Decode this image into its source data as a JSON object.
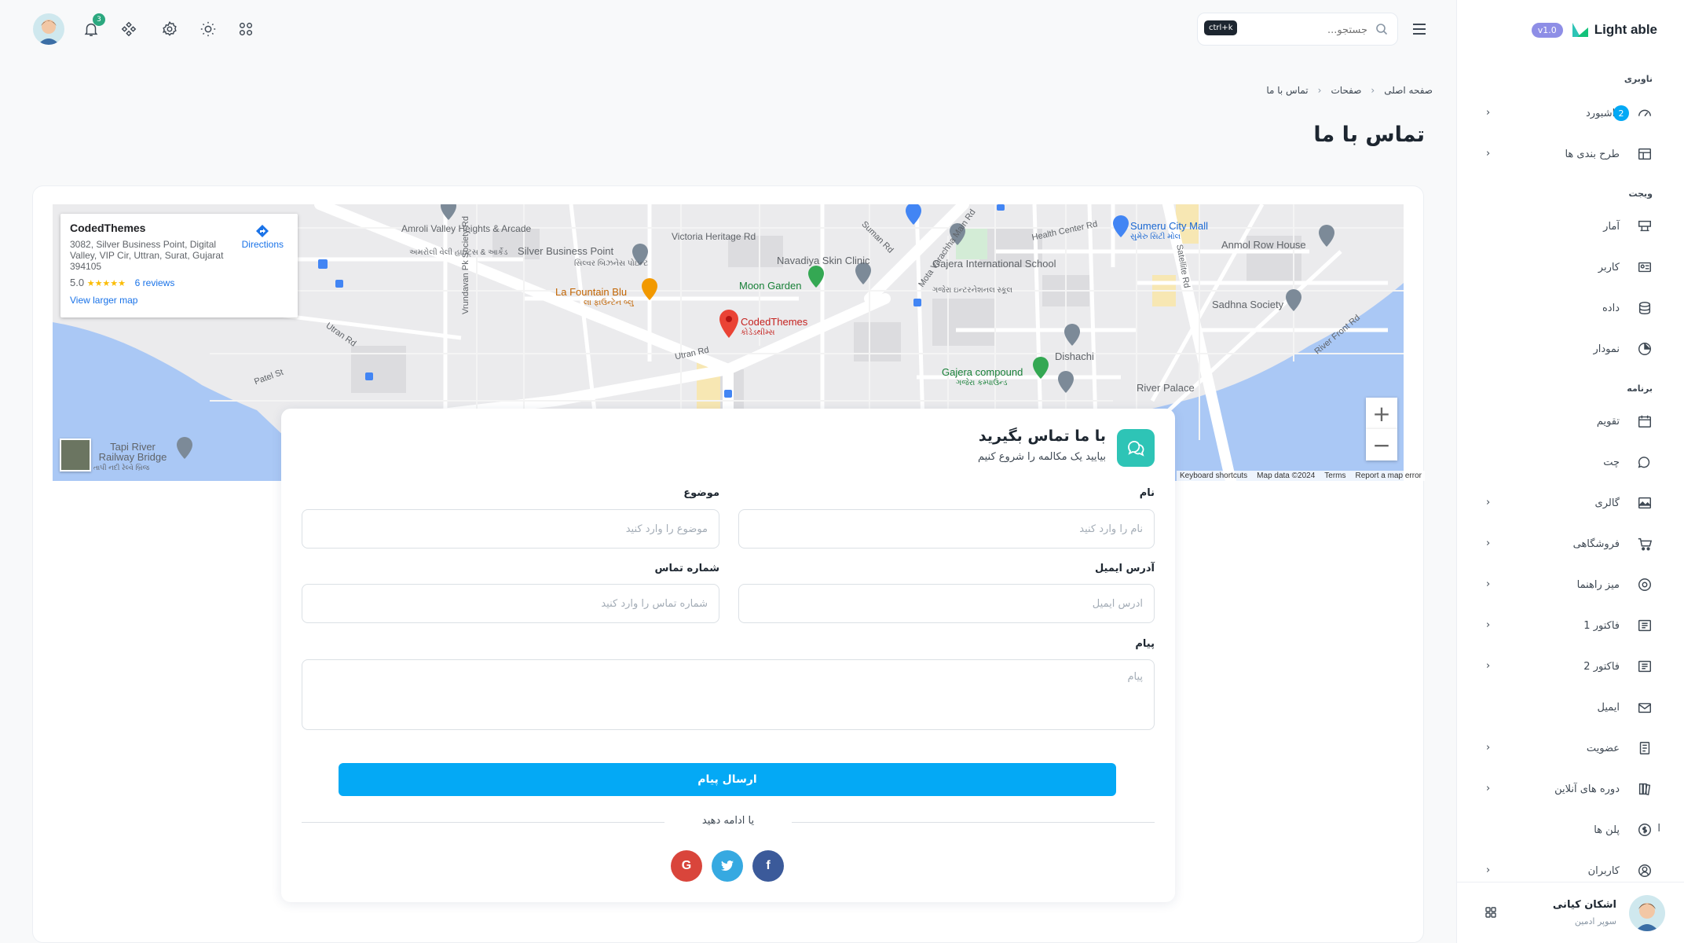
{
  "brand": {
    "name": "Light able",
    "version": "v1.0"
  },
  "header": {
    "search_placeholder": "جستجو...",
    "search_shortcut": "ctrl+k",
    "notification_count": "3"
  },
  "sidebar": {
    "captions": {
      "navigation": "ناوبری",
      "widget": "ویجت",
      "application": "برنامه"
    },
    "items": [
      {
        "label": "داشبورد",
        "icon": "dashboard-icon",
        "badge": "2",
        "chevron": true
      },
      {
        "label": "طرح بندی ها",
        "icon": "layout-icon",
        "chevron": true
      },
      {
        "label": "آمار",
        "icon": "statistics-icon"
      },
      {
        "label": "کاربر",
        "icon": "user-card-icon"
      },
      {
        "label": "داده",
        "icon": "database-icon"
      },
      {
        "label": "نمودار",
        "icon": "chart-icon"
      },
      {
        "label": "تقویم",
        "icon": "calendar-icon"
      },
      {
        "label": "چت",
        "icon": "chat-icon"
      },
      {
        "label": "گالری",
        "icon": "gallery-icon",
        "chevron": true
      },
      {
        "label": "فروشگاهی",
        "icon": "cart-icon",
        "chevron": true
      },
      {
        "label": "میز راهنما",
        "icon": "help-desk-icon",
        "chevron": true
      },
      {
        "label": "فاکتور 1",
        "icon": "invoice-icon",
        "chevron": true
      },
      {
        "label": "فاکتور 2",
        "icon": "invoice-icon",
        "chevron": true
      },
      {
        "label": "ایمیل",
        "icon": "mail-icon"
      },
      {
        "label": "عضویت",
        "icon": "membership-icon",
        "chevron": true
      },
      {
        "label": "دوره های آنلاین",
        "icon": "books-icon",
        "chevron": true
      },
      {
        "label": "پلن ها",
        "icon": "coin-icon",
        "extra": "ا"
      },
      {
        "label": "کاربران",
        "icon": "users-icon",
        "chevron": true
      }
    ],
    "user": {
      "name": "اشکان کیانی",
      "role": "سوپر ادمین"
    }
  },
  "breadcrumb": [
    "صفحه اصلی",
    "صفحات",
    "تماس با ما"
  ],
  "page_title": "تماس با ما",
  "map": {
    "place_name": "CodedThemes",
    "address": "3082, Silver Business Point, Digital Valley, VIP Cir, Uttran, Surat, Gujarat 394105",
    "rating": "5.0",
    "stars": "★★★★★",
    "reviews": "6 reviews",
    "view_larger": "View larger map",
    "directions": "Directions",
    "attribution": [
      "Keyboard shortcuts",
      "Map data ©2024",
      "Terms",
      "Report a map error"
    ],
    "labels": {
      "amroli": "Amroli",
      "amroli_gu": "અમરોલી",
      "silver_business_point": "Silver Business Point",
      "silver_gu": "સિલ્વર બિઝનેસ પોઇન્ટ",
      "victoria": "Victoria Heritage Rd",
      "navadiya": "Navadiya Skin Clinic",
      "moon_garden": "Moon Garden",
      "la_fountain": "La Fountain Blu",
      "la_fountain_gu": "લા ફાઉન્ટેન બ્લુ",
      "codedthemes": "CodedThemes",
      "codedthemes_gu": "કોડેડથીમ્સ",
      "gajera_school": "Gajera International School",
      "gajera_school_gu": "ગજેરા ઇન્ટરનેશનલ સ્કૂલ",
      "gajera_compound": "Gajera compound",
      "gajera_compound_gu": "ગજેરા કમ્પાઉન્ડ",
      "dishachi": "Dishachi",
      "sumeru": "Sumeru City Mall",
      "sumeru_gu": "સુમેરુ સિટી મોલ",
      "anmol": "Anmol Row House",
      "sadhna": "Sadhna Society",
      "river_palace": "River Palace",
      "tapi_bridge": "Tapi River Railway Bridge",
      "tapi_bridge_gu": "તાપી નદી રેલ્વે બ્રિજ",
      "vrundavan": "Vrundavan Pk Society Rd",
      "amroli_valley": "Amroli Valley Heights & Arcade",
      "amroli_valley_gu": "અમરોલી વેલી હાઇટ્સ & આર્કેડ",
      "utran_rd": "Utran Rd",
      "patel_st": "Patel St",
      "suman_rd": "Suman Rd",
      "mota_varachha": "Mota Varachha Main Rd",
      "health_center": "Health Center Rd",
      "satellite_rd": "Satellite Rd",
      "river_front_rd": "River Front Rd",
      "utran_rd2": "Utran Rd"
    }
  },
  "contact": {
    "title": "با ما تماس بگیرید",
    "subtitle": "بیایید یک مکالمه را شروع کنیم",
    "fields": {
      "name": {
        "label": "نام",
        "placeholder": "نام را وارد کنید"
      },
      "subject": {
        "label": "موضوع",
        "placeholder": "موضوع را وارد کنید"
      },
      "email": {
        "label": "آدرس ایمیل",
        "placeholder": "آدرس ایمیل"
      },
      "phone": {
        "label": "شماره تماس",
        "placeholder": "شماره تماس را وارد کنید"
      },
      "message": {
        "label": "پیام",
        "placeholder": "پیام"
      }
    },
    "submit": "ارسال پیام",
    "divider": "یا ادامه دهید",
    "social": {
      "google": "G",
      "twitter": "twitter",
      "facebook": "f"
    }
  },
  "colors": {
    "primary": "#04a9f5",
    "accent_teal": "#2ec4b6",
    "google": "#d9453b",
    "twitter": "#36a9e1",
    "facebook": "#3b5a9a",
    "success": "#2ca87f"
  }
}
